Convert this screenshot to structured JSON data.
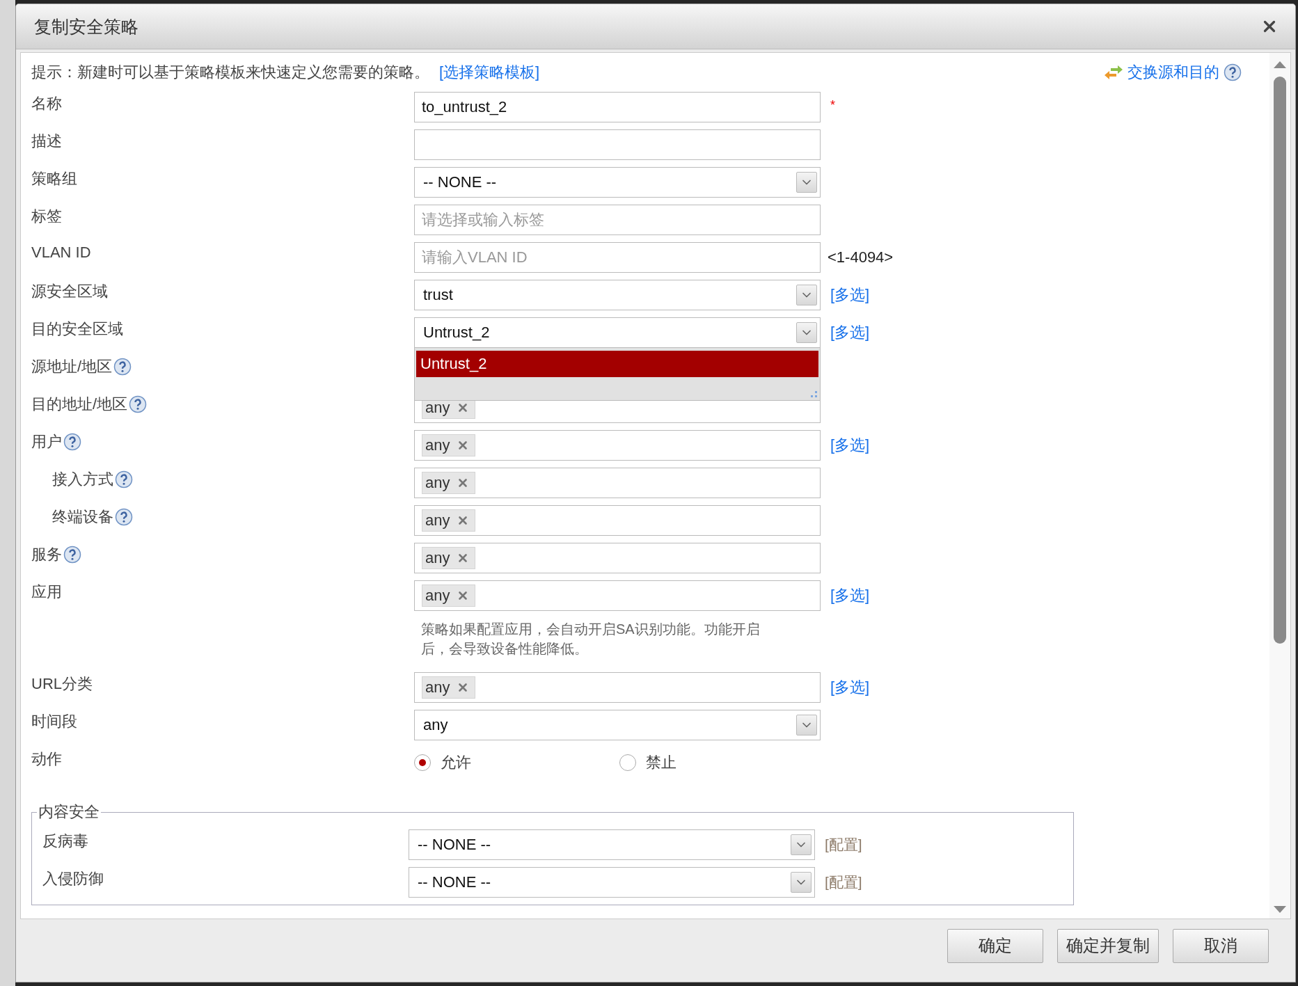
{
  "dialog": {
    "title": "复制安全策略"
  },
  "hint": {
    "text": "提示：新建时可以基于策略模板来快速定义您需要的策略。",
    "link": "[选择策略模板]"
  },
  "swap_link": {
    "label": "交换源和目的",
    "help": true
  },
  "fields": [
    {
      "label": "名称",
      "kind": "text",
      "value": "to_untrust_2",
      "required_mark": "*"
    },
    {
      "label": "描述",
      "kind": "text"
    },
    {
      "label": "策略组",
      "kind": "select",
      "value": "-- NONE --"
    },
    {
      "label": "标签",
      "kind": "text",
      "placeholder": "请选择或输入标签"
    },
    {
      "label": "VLAN ID",
      "kind": "text",
      "placeholder": "请输入VLAN ID",
      "suffix": "<1-4094>"
    },
    {
      "label": "源安全区域",
      "kind": "select",
      "value": "trust",
      "link": "[多选]"
    },
    {
      "label": "目的安全区域",
      "kind": "select",
      "value": "Untrust_2",
      "link": "[多选]",
      "expanded": true,
      "options": [
        {
          "label": "Untrust_2",
          "selected": true
        }
      ]
    },
    {
      "label": "源地址/地区",
      "help": true
    },
    {
      "label": "目的地址/地区",
      "help": true,
      "kind": "tags",
      "tags": [
        "any"
      ]
    },
    {
      "label": "用户",
      "help": true,
      "kind": "tags",
      "tags": [
        "any"
      ],
      "link": "[多选]",
      "children": [
        {
          "label": "接入方式",
          "help": true,
          "kind": "tags",
          "tags": [
            "any"
          ]
        },
        {
          "label": "终端设备",
          "help": true,
          "kind": "tags",
          "tags": [
            "any"
          ]
        }
      ]
    },
    {
      "label": "服务",
      "help": true,
      "kind": "tags",
      "tags": [
        "any"
      ]
    },
    {
      "label": "应用",
      "kind": "tags",
      "tags": [
        "any"
      ],
      "link": "[多选]",
      "note": "策略如果配置应用，会自动开启SA识别功能。功能开启后，会导致设备性能降低。"
    },
    {
      "label": "URL分类",
      "kind": "tags",
      "tags": [
        "any"
      ],
      "link": "[多选]"
    },
    {
      "label": "时间段",
      "kind": "select",
      "value": "any"
    },
    {
      "label": "动作",
      "kind": "radio",
      "options": [
        {
          "label": "允许",
          "selected": true
        },
        {
          "label": "禁止",
          "selected": false
        }
      ]
    }
  ],
  "content_security": {
    "legend": "内容安全",
    "fields": [
      {
        "label": "反病毒",
        "kind": "select",
        "value": "-- NONE --",
        "link": "[配置]"
      },
      {
        "label": "入侵防御",
        "kind": "select",
        "value": "-- NONE --",
        "link": "[配置]"
      }
    ]
  },
  "buttons": [
    {
      "label": "确定"
    },
    {
      "label": "确定并复制"
    },
    {
      "label": "取消"
    }
  ]
}
